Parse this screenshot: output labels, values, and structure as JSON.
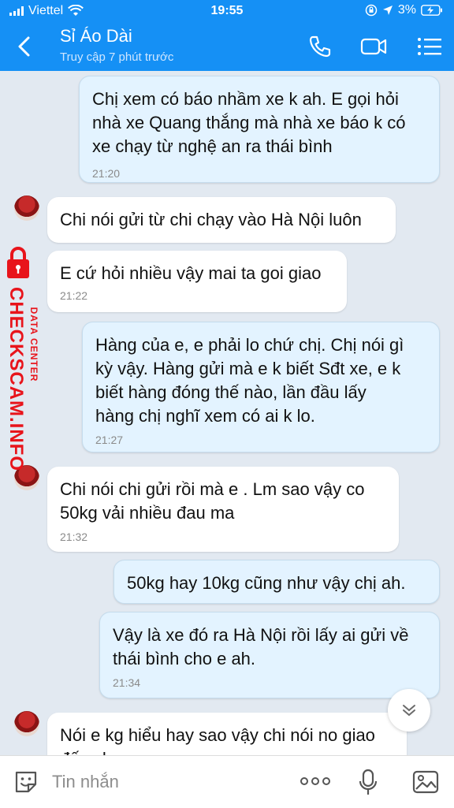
{
  "status_bar": {
    "carrier": "Viettel",
    "time": "19:55",
    "battery": "3%"
  },
  "header": {
    "title": "Sỉ Áo Dài",
    "subtitle": "Truy cập 7 phút trước"
  },
  "watermark": {
    "brand": "CHECKSCAM.INFO",
    "tagline": "DATA CENTER"
  },
  "messages": [
    {
      "direction": "out",
      "lines": [
        "Chị xem có báo nhầm xe k ah. E gọi hỏi",
        "nhà xe Quang thắng mà nhà xe báo k có",
        "xe chạy từ nghệ an ra thái bình"
      ],
      "time": "21:20"
    },
    {
      "direction": "in",
      "lines": [
        "Chi nói gửi từ chi chạy vào Hà Nội luôn"
      ],
      "time": ""
    },
    {
      "direction": "in",
      "lines": [
        "E cứ hỏi nhiều vậy mai ta goi giao"
      ],
      "time": "21:22"
    },
    {
      "direction": "out",
      "lines": [
        "Hàng của e, e phải lo chứ chị. Chị nói gì",
        "kỳ vậy. Hàng gửi mà e k biết Sđt xe, e k",
        "biết hàng đóng thế nào, lần đầu lấy",
        "hàng chị nghĩ xem có ai k lo."
      ],
      "time": "21:27"
    },
    {
      "direction": "in",
      "lines": [
        "Chi nói chi gửi rồi mà e . Lm sao vậy co",
        "50kg vải nhiều đau ma"
      ],
      "time": "21:32"
    },
    {
      "direction": "out",
      "lines": [
        "50kg hay 10kg cũng như vậy chị ah."
      ],
      "time": ""
    },
    {
      "direction": "out",
      "lines": [
        "Vậy là xe đó ra Hà Nội rồi lấy ai gửi về",
        "thái bình cho e ah."
      ],
      "time": "21:34"
    },
    {
      "direction": "in",
      "lines": [
        "Nói e kg hiểu hay sao vậy chi nói no giao",
        "đến cho e"
      ],
      "time": ""
    }
  ],
  "input": {
    "placeholder": "Tin nhắn"
  },
  "colors": {
    "header_blue": "#1590f5",
    "outgoing_bubble": "#e3f3ff",
    "incoming_bubble": "#ffffff",
    "watermark_red": "#e8141b"
  },
  "icons": [
    "back-chevron-icon",
    "phone-icon",
    "video-camera-icon",
    "list-menu-icon",
    "chevron-down-icon",
    "sticker-icon",
    "more-dots-icon",
    "microphone-icon",
    "image-icon"
  ]
}
